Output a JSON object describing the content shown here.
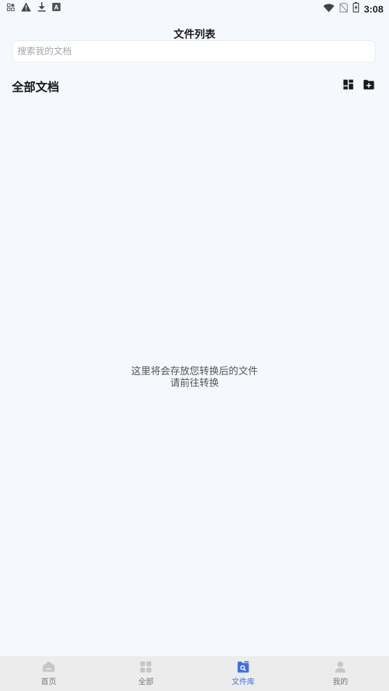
{
  "status_bar": {
    "time": "3:08",
    "left_icons": [
      "app-grid-icon",
      "warning-icon",
      "download-icon",
      "font-a-icon"
    ],
    "right_icons": [
      "wifi-icon",
      "no-sim-icon",
      "battery-charging-icon"
    ]
  },
  "header": {
    "title": "文件列表"
  },
  "search": {
    "placeholder": "搜索我的文档",
    "value": ""
  },
  "section": {
    "title": "全部文档",
    "actions": [
      "layout-toggle-icon",
      "new-folder-icon"
    ]
  },
  "empty_state": {
    "line1": "这里将会存放您转换后的文件",
    "line2": "请前往转换"
  },
  "bottom_nav": {
    "items": [
      {
        "label": "首页",
        "icon": "home-icon",
        "active": false
      },
      {
        "label": "全部",
        "icon": "grid-icon",
        "active": false
      },
      {
        "label": "文件库",
        "icon": "file-library-icon",
        "active": true
      },
      {
        "label": "我的",
        "icon": "user-icon",
        "active": false
      }
    ]
  },
  "colors": {
    "background": "#f5f8fd",
    "accent": "#3d6ee8",
    "nav_background": "#ececec",
    "inactive_icon": "#c4c6ca"
  }
}
